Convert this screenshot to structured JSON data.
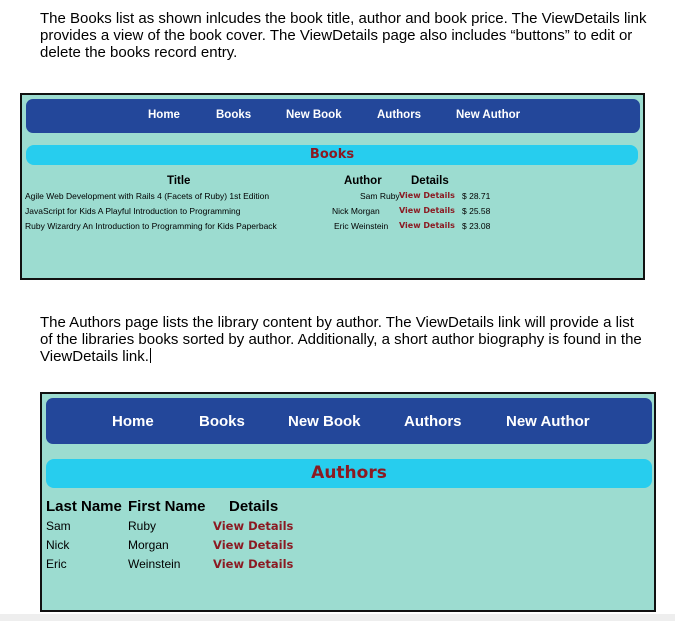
{
  "document": {
    "paragraph1": "The Books list as shown inlcudes the book title, author and book price.  The ViewDetails link provides a view of the book cover.  The ViewDetails page also includes “buttons” to edit or delete the books record entry.",
    "paragraph2": "The Authors page lists the library content by author.  The ViewDetails link will provide a list of the libraries books sorted by author.  Additionally, a short author biography is found in the ViewDetails link."
  },
  "books_screenshot": {
    "nav": [
      "Home",
      "Books",
      "New Book",
      "Authors",
      "New Author"
    ],
    "title": "Books",
    "headers": {
      "title": "Title",
      "author": "Author",
      "details": "Details"
    },
    "rows": [
      {
        "title": "Agile Web Development with Rails 4 (Facets of Ruby) 1st Edition",
        "author": "Sam Ruby",
        "link": "View Details",
        "price": "$ 28.71"
      },
      {
        "title": "JavaScript for Kids A Playful Introduction to Programming",
        "author": "Nick Morgan",
        "link": "View Details",
        "price": "$ 25.58"
      },
      {
        "title": "Ruby Wizardry An Introduction to Programming for Kids Paperback",
        "author": "Eric Weinstein",
        "link": "View Details",
        "price": "$ 23.08"
      }
    ]
  },
  "authors_screenshot": {
    "nav": [
      "Home",
      "Books",
      "New Book",
      "Authors",
      "New Author"
    ],
    "title": "Authors",
    "headers": {
      "last": "Last Name",
      "first": "First Name",
      "details": "Details"
    },
    "rows": [
      {
        "last": "Sam",
        "first": "Ruby",
        "link": "View Details"
      },
      {
        "last": "Nick",
        "first": "Morgan",
        "link": "View Details"
      },
      {
        "last": "Eric",
        "first": "Weinstein",
        "link": "View Details"
      }
    ]
  },
  "colors": {
    "nav_background": "#23479a",
    "title_bar": "#27cdee",
    "panel_background": "#9cdcd0",
    "link_text": "#8b1a22"
  }
}
